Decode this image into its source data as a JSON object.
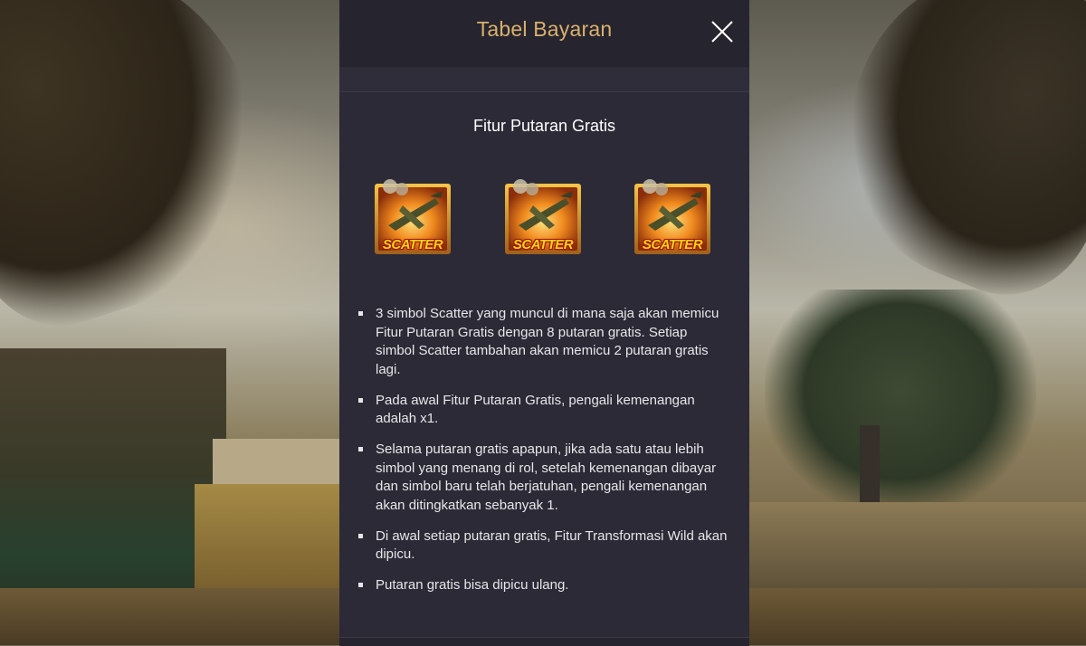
{
  "dialog": {
    "title": "Tabel Bayaran",
    "close_icon": "close-icon"
  },
  "feature": {
    "heading": "Fitur Putaran Gratis",
    "symbols": [
      {
        "label": "SCATTER"
      },
      {
        "label": "SCATTER"
      },
      {
        "label": "SCATTER"
      }
    ],
    "rules": [
      "3 simbol Scatter yang muncul di mana saja akan memicu Fitur Putaran Gratis dengan 8 putaran gratis. Setiap simbol Scatter tambahan akan memicu 2 putaran gratis lagi.",
      "Pada awal Fitur Putaran Gratis, pengali kemenangan adalah x1.",
      "Selama putaran gratis apapun, jika ada satu atau lebih simbol yang menang di rol, setelah kemenangan dibayar dan simbol baru telah berjatuhan, pengali kemenangan akan ditingkatkan sebanyak 1.",
      "Di awal setiap putaran gratis, Fitur Transformasi Wild akan dipicu.",
      "Putaran gratis bisa dipicu ulang."
    ]
  },
  "colors": {
    "title_gold": "#d9b06c",
    "panel_bg": "#2b2a36",
    "header_bg": "#26252f",
    "scatter_text": "#ffd21a"
  }
}
